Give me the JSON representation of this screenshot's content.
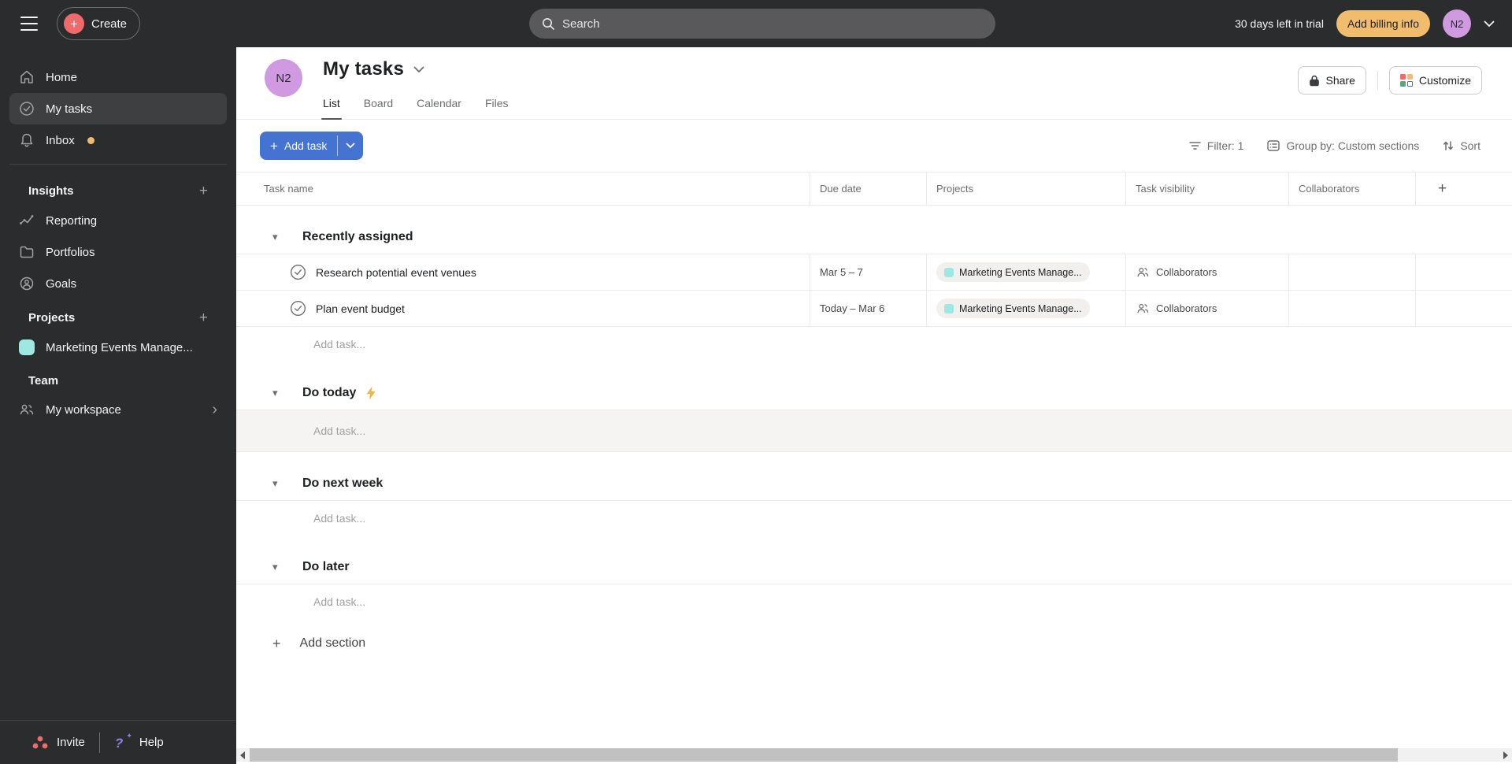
{
  "topbar": {
    "create_label": "Create",
    "search_placeholder": "Search",
    "trial_text": "30 days left in trial",
    "billing_label": "Add billing info",
    "avatar_initials": "N2"
  },
  "sidebar": {
    "home": "Home",
    "my_tasks": "My tasks",
    "inbox": "Inbox",
    "insights_title": "Insights",
    "reporting": "Reporting",
    "portfolios": "Portfolios",
    "goals": "Goals",
    "projects_title": "Projects",
    "project_name": "Marketing Events Manage...",
    "team_title": "Team",
    "workspace": "My workspace",
    "invite_label": "Invite",
    "help_label": "Help"
  },
  "header": {
    "avatar_initials": "N2",
    "title": "My tasks",
    "tabs": {
      "list": "List",
      "board": "Board",
      "calendar": "Calendar",
      "files": "Files"
    },
    "share_label": "Share",
    "customize_label": "Customize"
  },
  "toolbar": {
    "add_task_label": "Add task",
    "filter_label": "Filter: 1",
    "group_label": "Group by: Custom sections",
    "sort_label": "Sort"
  },
  "table": {
    "columns": {
      "task": "Task name",
      "due": "Due date",
      "projects": "Projects",
      "visibility": "Task visibility",
      "collaborators": "Collaborators"
    },
    "sections": [
      {
        "name": "Recently assigned",
        "add_task": "Add task...",
        "tasks": [
          {
            "name": "Research potential event venues",
            "due": "Mar 5 – 7",
            "project": "Marketing Events Manage...",
            "visibility": "Collaborators"
          },
          {
            "name": "Plan event budget",
            "due": "Today – Mar 6",
            "project": "Marketing Events Manage...",
            "visibility": "Collaborators"
          }
        ]
      },
      {
        "name": "Do today",
        "add_task": "Add task..."
      },
      {
        "name": "Do next week",
        "add_task": "Add task..."
      },
      {
        "name": "Do later",
        "add_task": "Add task..."
      }
    ],
    "add_section_label": "Add section"
  },
  "icons": {
    "plus": "+",
    "triangle": "▾",
    "chevron_right": "›",
    "help_question": "?",
    "sparkle": "✦"
  },
  "colors": {
    "accent_blue": "#4573d2",
    "billing_yellow": "#f1bd6c",
    "avatar_purple": "#cf9ae0",
    "project_teal": "#9ee7e3",
    "coral": "#f06a6a",
    "bolt_orange": "#f2b643",
    "help_purple": "#8d84e8",
    "dark_bg": "#2b2c2e"
  }
}
